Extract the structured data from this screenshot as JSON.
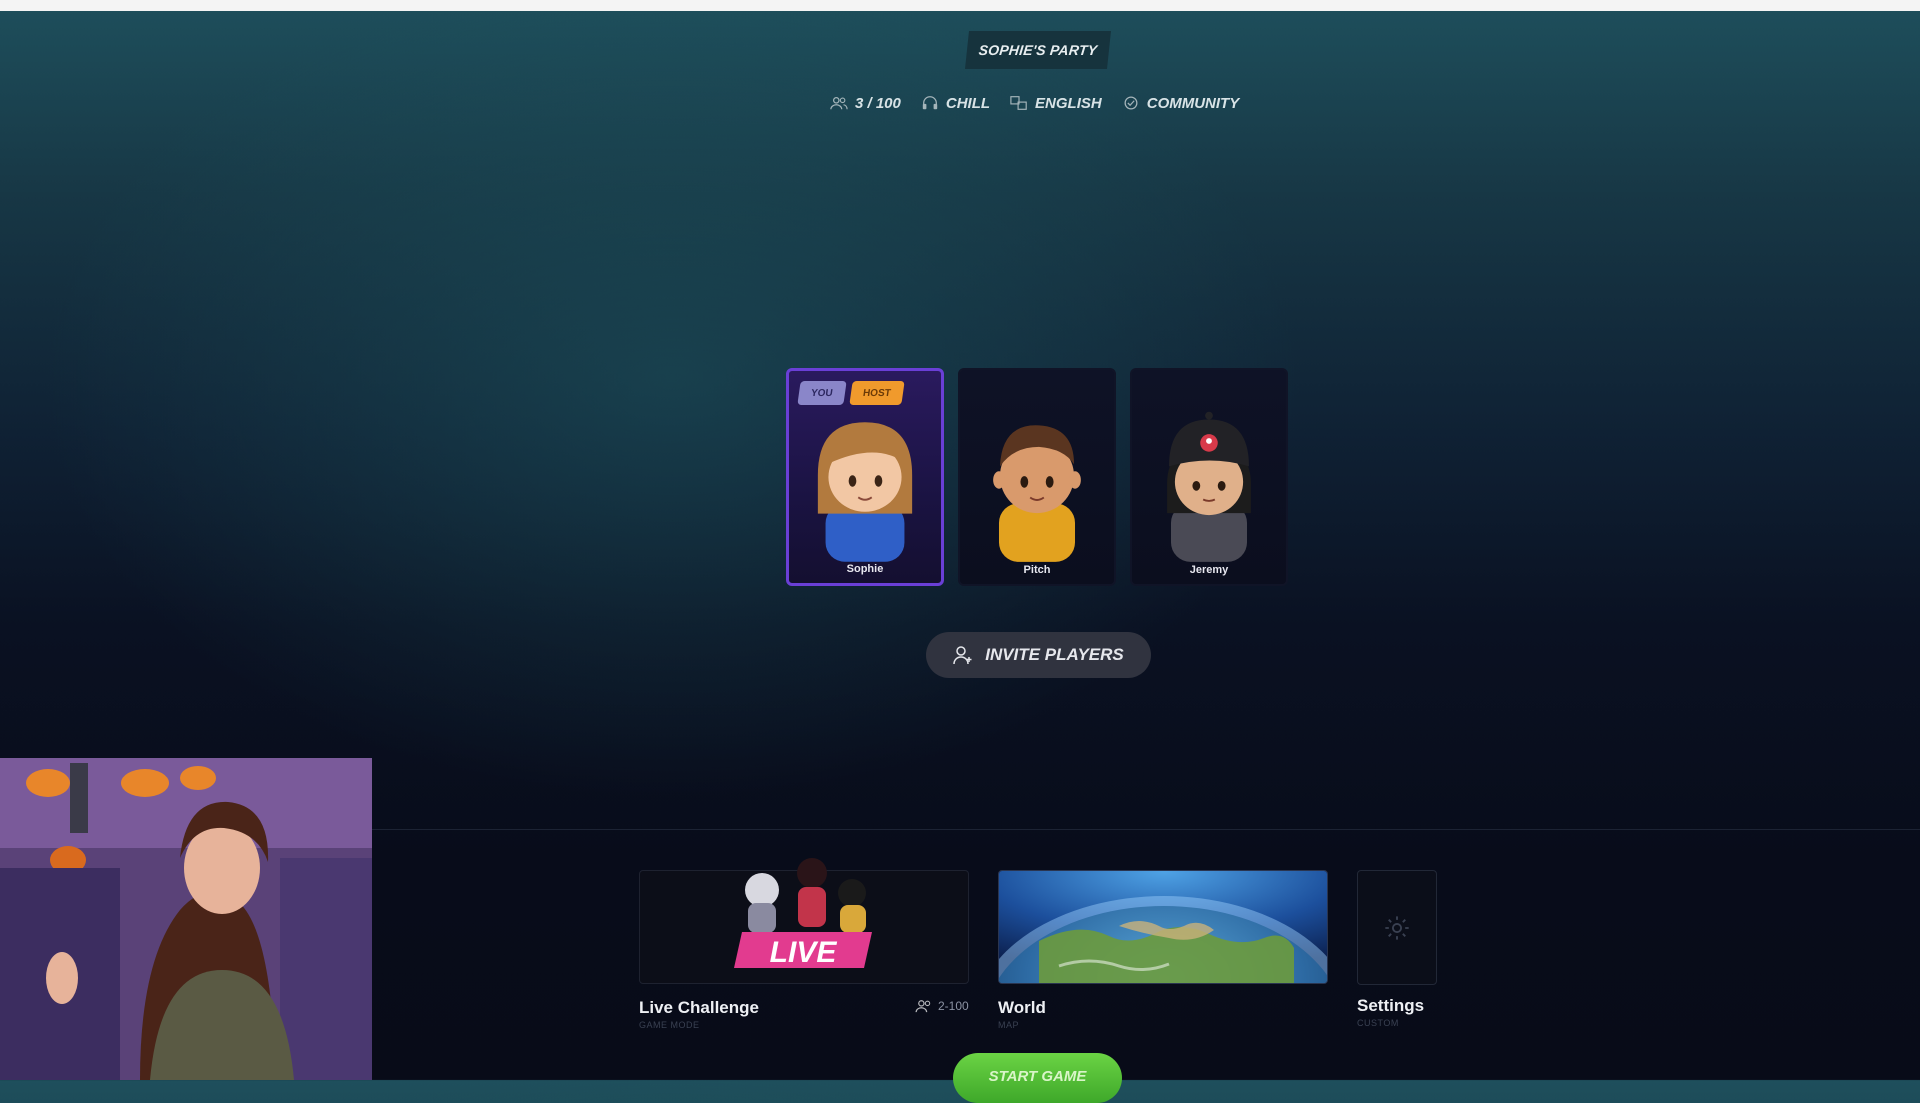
{
  "lobby": {
    "party_name": "SOPHIE'S PARTY",
    "player_count": "3 / 100",
    "vibe": "CHILL",
    "language": "ENGLISH",
    "lobby_type": "COMMUNITY"
  },
  "players": [
    {
      "name": "Sophie",
      "badges": [
        "YOU",
        "HOST"
      ],
      "shirt_color": "#2f5fc7",
      "hair_color": "#b27a3e"
    },
    {
      "name": "Pitch",
      "badges": [],
      "shirt_color": "#e2a21f",
      "hair_color": "#5a3520"
    },
    {
      "name": "Jeremy",
      "badges": [],
      "shirt_color": "#4a4a55",
      "hair_color": "#1c1c1c"
    }
  ],
  "invite_button": {
    "label": "INVITE PLAYERS",
    "icon": "add-user-icon"
  },
  "game_mode": {
    "label": "Live Challenge",
    "sublabel": "GAME MODE",
    "players": "2-100",
    "art_text": "LIVE",
    "accent": "#e23b8f"
  },
  "map": {
    "label": "World",
    "sublabel": "MAP"
  },
  "settings": {
    "label": "Settings",
    "sublabel": "CUSTOM",
    "icon": "gear-icon"
  },
  "start_button": {
    "label": "START GAME",
    "color": "#5cc23a"
  },
  "colors": {
    "background_top": "#1e4f5c",
    "background_bottom": "#080b18",
    "self_card_border": "#6a3fd6",
    "host_badge": "#f09a2c",
    "you_badge": "#8a86c9"
  }
}
